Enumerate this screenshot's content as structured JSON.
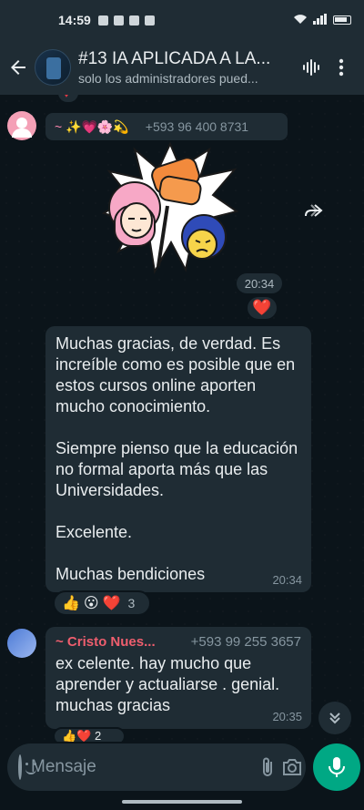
{
  "status_bar": {
    "time": "14:59",
    "battery_color": "#e9edef"
  },
  "header": {
    "title": "#13 IA APLICADA A LA...",
    "subtitle": "solo los administradores pued...",
    "icons": [
      "back-arrow-icon",
      "voice-chat-icon",
      "more-options-icon"
    ]
  },
  "messages": {
    "first_sender": {
      "display_emojis": "~ ✨💗🌸💫",
      "phone": "+593 96 400 8731"
    },
    "sticker_time": "20:34",
    "sticker_reaction": "❤️",
    "long_message": {
      "paragraphs": [
        "Muchas gracias, de verdad. Es increíble como es posible que en estos cursos online aporten mucho conocimiento.",
        "Siempre pienso que la educación no formal aporta más que las Universidades.",
        "Excelente.",
        "Muchas bendiciones"
      ],
      "time": "20:34",
      "reactions": [
        "👍",
        "😮",
        "❤️"
      ],
      "reaction_count": "3"
    },
    "second_message": {
      "sender_name": "~ Cristo Nues...",
      "sender_phone": "+593 99 255 3657",
      "text": "ex celente. hay mucho que aprender y actualiarse . genial. muchas gracias",
      "time": "20:35",
      "reactions": "👍❤️ 2"
    }
  },
  "composer": {
    "placeholder": "Mensaje"
  },
  "colors": {
    "background": "#0b141a",
    "bubble": "#1f2c34",
    "accent": "#00a884",
    "sender_name": "#ef5e6e"
  }
}
